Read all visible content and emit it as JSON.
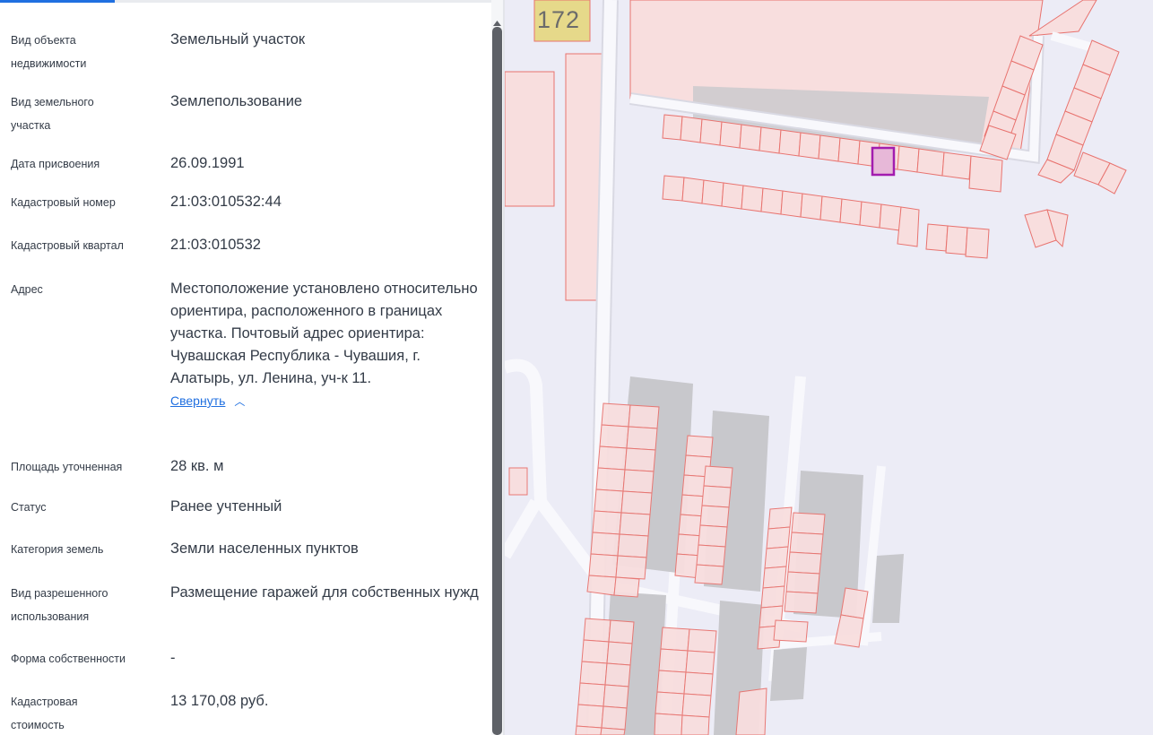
{
  "properties": [
    {
      "label": "Вид объекта недвижимости",
      "value": "Земельный участок"
    },
    {
      "label": "Вид земельного участка",
      "value": "Землепользование"
    },
    {
      "label": "Дата присвоения",
      "value": "26.09.1991"
    },
    {
      "label": "Кадастровый номер",
      "value": "21:03:010532:44"
    },
    {
      "label": "Кадастровый квартал",
      "value": "21:03:010532"
    },
    {
      "label": "Адрес",
      "value": "Местоположение установлено относительно ориентира, расположенного в границах участка. Почтовый адрес ориентира: Чувашская Республика - Чувашия, г. Алатырь, ул. Ленина, уч-к 11.",
      "collapse_link": "Свернуть"
    },
    {
      "label": "Площадь уточненная",
      "value": "28 кв. м"
    },
    {
      "label": "Статус",
      "value": "Ранее учтенный"
    },
    {
      "label": "Категория земель",
      "value": "Земли населенных пунктов"
    },
    {
      "label": "Вид разрешенного использования",
      "value": "Размещение гаражей для собственных нужд"
    },
    {
      "label": "Форма собственности",
      "value": "-"
    },
    {
      "label": "Кадастровая стоимость",
      "value": "13 170,08 руб."
    }
  ],
  "map": {
    "label_number": "172",
    "colors": {
      "background": "#ececf6",
      "parcel_fill": "#f8dede",
      "parcel_stroke": "#e8736f",
      "building": "#c8c8cc",
      "road": "#f8f8fc",
      "selected_parcel": "#a21caf",
      "label_tile": "#e6d98a"
    }
  },
  "icons": {
    "collapse": "chevron-up-icon"
  }
}
